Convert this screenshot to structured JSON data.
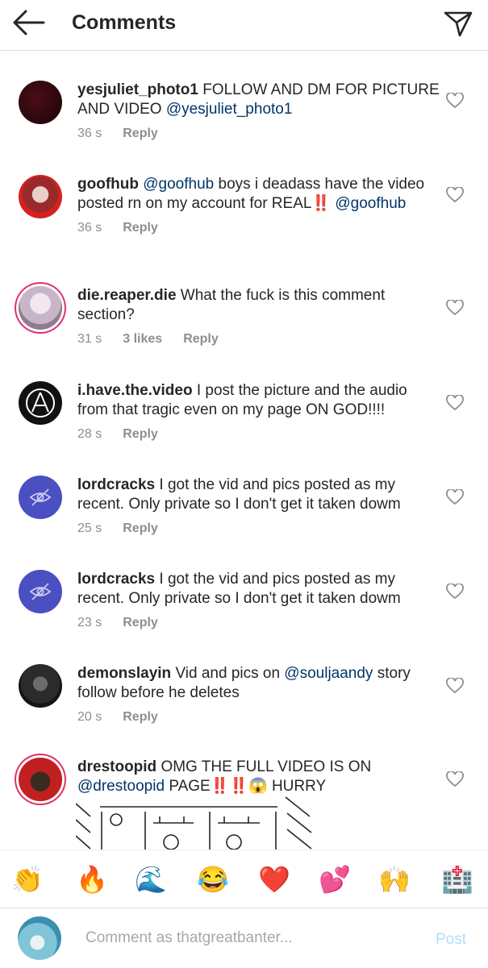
{
  "header": {
    "title": "Comments"
  },
  "comments": [
    {
      "username": "yesjuliet_photo1",
      "text": "FOLLOW AND DM FOR PICTURE AND VIDEO",
      "mention": "@yesjuliet_photo1",
      "time": "36 s",
      "reply": "Reply"
    },
    {
      "username": "goofhub",
      "mention": "@goofhub",
      "text": "boys i deadass have the video posted rn on my account for REAL‼️",
      "mention2": "@goofhub",
      "time": "36 s",
      "reply": "Reply"
    },
    {
      "username": "die.reaper.die",
      "text": "What the fuck is this comment section?",
      "time": "31 s",
      "likes": "3 likes",
      "reply": "Reply"
    },
    {
      "username": "i.have.the.video",
      "text": "I post the picture and the audio from that tragic even on my page ON GOD!!!!",
      "time": "28 s",
      "reply": "Reply"
    },
    {
      "username": "lordcracks",
      "text": "I got the vid and pics posted as my recent. Only private so I don't get it taken dowm",
      "time": "25 s",
      "reply": "Reply"
    },
    {
      "username": "lordcracks",
      "text": "I got the vid and pics posted as my recent. Only private so I don't get it taken dowm",
      "time": "23 s",
      "reply": "Reply"
    },
    {
      "username": "demonslayin",
      "text": "Vid and pics on",
      "mention": "@souljaandy",
      "text2": "story follow before he deletes",
      "time": "20 s",
      "reply": "Reply"
    },
    {
      "username": "drestoopid",
      "text": "OMG THE FULL VIDEO IS ON",
      "mention": "@drestoopid",
      "text2": "PAGE‼️‼️😱 HURRY"
    }
  ],
  "emojis": [
    "👏",
    "🔥",
    "🌊",
    "😂",
    "❤️",
    "💕",
    "🙌",
    "🏥"
  ],
  "input": {
    "placeholder": "Comment as thatgreatbanter...",
    "post_label": "Post"
  },
  "colors": {
    "mention": "#003569",
    "meta": "#8e8e8e",
    "post_disabled": "#b2dffc",
    "story_ring": "#e1306c"
  }
}
